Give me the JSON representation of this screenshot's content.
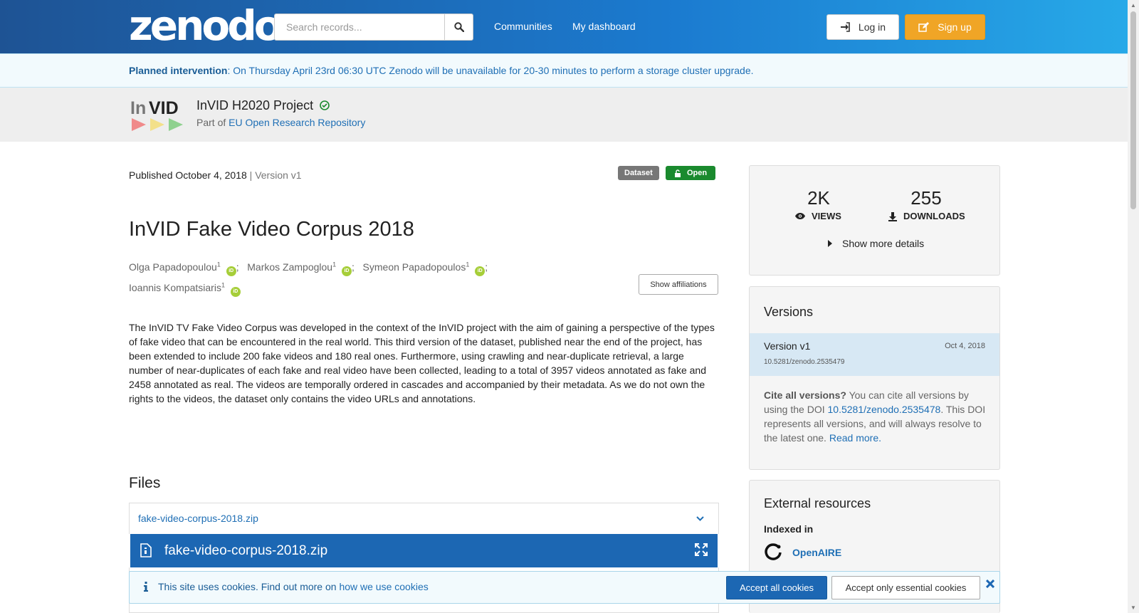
{
  "header": {
    "logo_text": "zenodo",
    "search_placeholder": "Search records...",
    "nav": [
      "Communities",
      "My dashboard"
    ],
    "login_label": "Log in",
    "signup_label": "Sign up"
  },
  "banner": {
    "bold": "Planned intervention",
    "text": ": On Thursday April 23rd 06:30 UTC Zenodo will be unavailable for 20-30 minutes to perform a storage cluster upgrade."
  },
  "community": {
    "logo_text": "InVID",
    "title": "InVID H2020 Project",
    "part_of": "Part of",
    "repo": "EU Open Research Repository"
  },
  "record": {
    "published": "Published October 4, 2018",
    "version": "| Version v1",
    "badge_type": "Dataset",
    "badge_access": "Open",
    "title": "InVID Fake Video Corpus 2018",
    "authors": [
      {
        "name": "Olga Papadopoulou",
        "aff": "1"
      },
      {
        "name": "Markos Zampoglou",
        "aff": "1"
      },
      {
        "name": "Symeon Papadopoulos",
        "aff": "1"
      },
      {
        "name": "Ioannis Kompatsiaris",
        "aff": "1"
      }
    ],
    "orcid_label": "iD",
    "show_affiliations": "Show affiliations",
    "description": "The InVID TV Fake Video Corpus was developed in the context of the InVID project with the aim of gaining a perspective of the types of fake video that can be encountered in the real world. This third version of the dataset, published near the end of the project, has been extended to include 200 fake videos and 180 real ones. Furthermore, using crawling and near-duplicate retrieval, a large number of near-duplicates of each fake and real video have been collected, leading to a total of 3957 videos annotated as fake and 2458 annotated as real. The videos are temporally ordered in cascades and accompanied by their metadata. As we do not own the rights to the videos, the dataset only contains the video URLs and annotations."
  },
  "files": {
    "heading": "Files",
    "file_name": "fake-video-corpus-2018.zip",
    "preview_name": "fake-video-corpus-2018.zip"
  },
  "stats": {
    "views": "2K",
    "views_label": "VIEWS",
    "downloads": "255",
    "downloads_label": "DOWNLOADS",
    "more_details": "Show more details"
  },
  "versions": {
    "heading": "Versions",
    "items": [
      {
        "name": "Version v1",
        "date": "Oct 4, 2018",
        "doi": "10.5281/zenodo.2535479"
      }
    ],
    "cite_bold": "Cite all versions?",
    "cite_text1": " You can cite all versions by using the DOI ",
    "cite_doi": "10.5281/zenodo.2535478",
    "cite_text2": ". This DOI represents all versions, and will always resolve to the latest one. ",
    "read_more": "Read more."
  },
  "external": {
    "heading": "External resources",
    "indexed_in": "Indexed in",
    "resource": "OpenAIRE"
  },
  "cookie": {
    "text": "This site uses cookies. Find out more on ",
    "link": "how we use cookies",
    "accept_all": "Accept all cookies",
    "accept_essential": "Accept only essential cookies"
  }
}
